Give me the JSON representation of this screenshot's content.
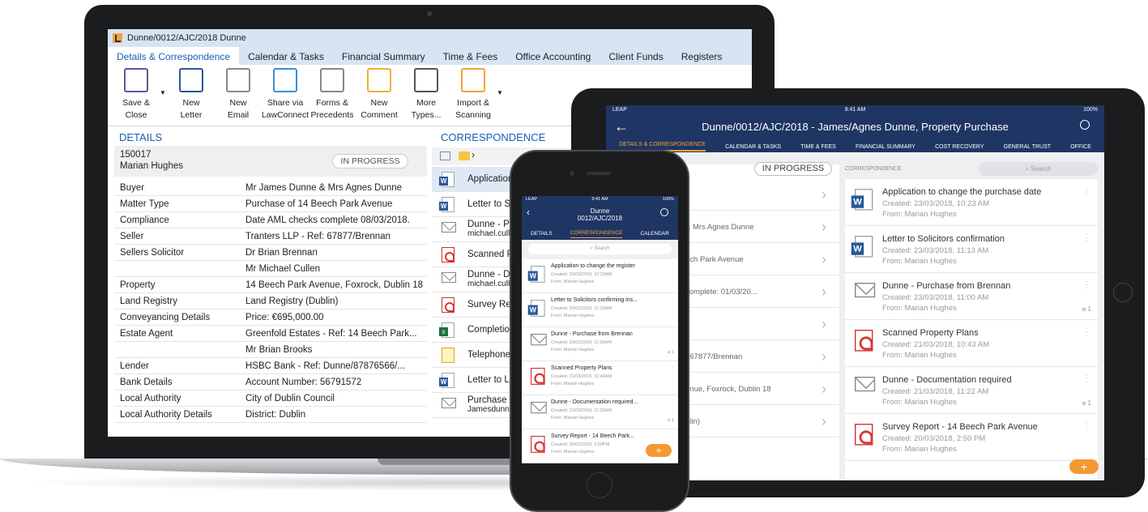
{
  "laptop": {
    "window_title": "Dunne/0012/AJC/2018 Dunne",
    "tabs": [
      "Details & Correspondence",
      "Calendar & Tasks",
      "Financial Summary",
      "Time & Fees",
      "Office Accounting",
      "Client Funds",
      "Registers"
    ],
    "ribbon": [
      {
        "icon": "save-close-icon",
        "line1": "Save &",
        "line2": "Close"
      },
      {
        "icon": "new-letter-icon",
        "line1": "New",
        "line2": "Letter"
      },
      {
        "icon": "new-email-icon",
        "line1": "New",
        "line2": "Email"
      },
      {
        "icon": "lawconnect-share-icon",
        "line1": "Share via",
        "line2": "LawConnect"
      },
      {
        "icon": "forms-precedents-icon",
        "line1": "Forms &",
        "line2": "Precedents"
      },
      {
        "icon": "new-comment-icon",
        "line1": "New",
        "line2": "Comment"
      },
      {
        "icon": "more-types-icon",
        "line1": "More",
        "line2": "Types..."
      },
      {
        "icon": "import-scanning-icon",
        "line1": "Import &",
        "line2": "Scanning"
      }
    ],
    "details_heading": "DETAILS",
    "matter_number": "150017",
    "matter_person": "Marian Hughes",
    "status": "IN PROGRESS",
    "details": [
      [
        "Buyer",
        "Mr James Dunne & Mrs Agnes Dunne"
      ],
      [
        "Matter Type",
        "Purchase of 14 Beech Park Avenue"
      ],
      [
        "Compliance",
        "Date AML checks complete 08/03/2018."
      ],
      [
        "Seller",
        "Tranters LLP - Ref: 67877/Brennan"
      ],
      [
        "Sellers Solicitor",
        "Dr Brian Brennan"
      ],
      [
        "",
        "Mr Michael Cullen"
      ],
      [
        "Property",
        "14 Beech Park Avenue, Foxrock, Dublin 18"
      ],
      [
        "Land Registry",
        "Land Registry (Dublin)"
      ],
      [
        "Conveyancing Details",
        "Price: €695,000.00"
      ],
      [
        "Estate Agent",
        "Greenfold Estates - Ref: 14 Beech Park..."
      ],
      [
        "",
        "Mr Brian Brooks"
      ],
      [
        "Lender",
        "HSBC Bank - Ref: Dunne/87876566/..."
      ],
      [
        "Bank Details",
        "Account Number: 56791572"
      ],
      [
        "Local Authority",
        "City of Dublin Council"
      ],
      [
        "Local Authority Details",
        "District: Dublin"
      ]
    ],
    "correspondence_heading": "CORRESPONDENCE",
    "correspondence": [
      {
        "type": "word",
        "title": "Application",
        "sub": ""
      },
      {
        "type": "word",
        "title": "Letter to So",
        "sub": ""
      },
      {
        "type": "mail",
        "title": "Dunne - Pu",
        "sub": "michael.culle"
      },
      {
        "type": "pdf",
        "title": "Scanned P",
        "sub": ""
      },
      {
        "type": "mail",
        "title": "Dunne - Do",
        "sub": "michael.culle"
      },
      {
        "type": "pdf",
        "title": "Survey Rep",
        "sub": ""
      },
      {
        "type": "xls",
        "title": "Completion",
        "sub": ""
      },
      {
        "type": "note",
        "title": "Telephone w",
        "sub": ""
      },
      {
        "type": "word",
        "title": "Letter to Le",
        "sub": ""
      },
      {
        "type": "mail",
        "title": "Purchase fr",
        "sub": "Jamesdunne"
      }
    ]
  },
  "tablet": {
    "status_left": "LEAP",
    "status_time": "9:41 AM",
    "status_battery": "100%",
    "title": "Dunne/0012/AJC/2018 - James/Agnes Dunne, Property Purchase",
    "tabs": [
      "DETAILS & CORRESPONDENCE",
      "CALENDAR & TASKS",
      "TIME & FEES",
      "FINANCIAL SUMMARY",
      "COST RECOVERY",
      "GENERAL TRUST",
      "OFFICE"
    ],
    "status": "IN PROGRESS",
    "left_rows": [
      "",
      "& Mrs Agnes Dunne",
      "ech Park Avenue",
      "complete: 01/03/20...",
      "",
      ": 67877/Brennan",
      "enue, Foxrock, Dublin 18",
      "blin)"
    ],
    "correspondence_heading": "CORRESPONDENCE",
    "search_placeholder": "Search",
    "items": [
      {
        "type": "word",
        "title": "Application to change the purchase date",
        "created": "Created: 23/03/2018,  10:23 AM",
        "from": "From: Marian Hughes",
        "att": ""
      },
      {
        "type": "word",
        "title": "Letter to Solicitors confirmation",
        "created": "Created: 23/03/2018,  11:13 AM",
        "from": "From: Marian Hughes",
        "att": ""
      },
      {
        "type": "mail",
        "title": "Dunne - Purchase from Brennan",
        "created": "Created: 23/03/2018, 11:00 AM",
        "from": "From: Marian Hughes",
        "att": "1"
      },
      {
        "type": "pdf",
        "title": "Scanned Property Plans",
        "created": "Created: 21/03/2018,  10:43 AM",
        "from": "From: Marian Hughes",
        "att": ""
      },
      {
        "type": "mail",
        "title": "Dunne - Documentation required",
        "created": "Created: 21/03/2018, 11:22 AM",
        "from": "From: Marian Hughes",
        "att": "1"
      },
      {
        "type": "pdf",
        "title": "Survey Report - 14 Beech Park Avenue",
        "created": "Created: 20/03/2018,    2:50 PM",
        "from": "From: Marian Hughes",
        "att": ""
      }
    ],
    "fab": "+"
  },
  "phone": {
    "status_left": "LEAP",
    "status_time": "9:41 AM",
    "status_battery": "100%",
    "title_line1": "Dunne",
    "title_line2": "0012/AJC/2018",
    "tabs": [
      "DETAILS",
      "CORRESPONDENCE",
      "CALENDAR"
    ],
    "search_placeholder": "Search",
    "items": [
      {
        "type": "word",
        "title": "Application to change the register",
        "created": "Created: 23/03/2018, 10:23AM",
        "from": "From: Marian Hughes",
        "att": ""
      },
      {
        "type": "word",
        "title": "Letter to Solicitors confirming ins...",
        "created": "Created: 23/03/2018, 11:13AM",
        "from": "From: Marian Hughes",
        "att": ""
      },
      {
        "type": "mail",
        "title": "Dunne - Purchase from Brennan",
        "created": "Created: 23/03/2018, 11:00AM",
        "from": "From: Marian Hughes",
        "att": "1"
      },
      {
        "type": "pdf",
        "title": "Scanned Property Plans",
        "created": "Created: 21/03/2018, 10:43AM",
        "from": "From: Marian Hughes",
        "att": ""
      },
      {
        "type": "mail",
        "title": "Dunne - Documentation required...",
        "created": "Created: 21/03/2018, 11:22AM",
        "from": "From: Marian Hughes",
        "att": "1"
      },
      {
        "type": "pdf",
        "title": "Survey Report - 14 Beech Park...",
        "created": "Created: 20/03/2018, 2:50PM",
        "from": "From: Marian Hughes",
        "att": ""
      }
    ],
    "fab": "+"
  }
}
